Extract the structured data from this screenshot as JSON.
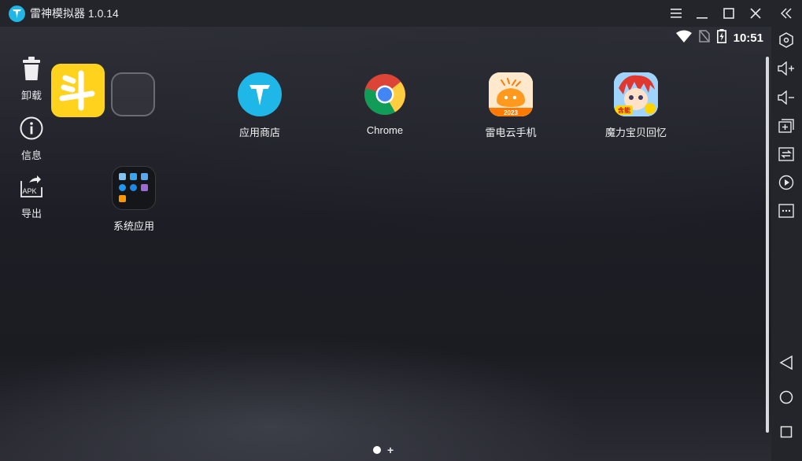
{
  "titlebar": {
    "title": "雷神模拟器 1.0.14",
    "buttons": [
      "menu-icon",
      "minimize-icon",
      "maximize-icon",
      "close-icon"
    ]
  },
  "statusbar": {
    "time": "10:51",
    "icons": [
      "wifi-icon",
      "no-sim-icon",
      "battery-charging-icon"
    ]
  },
  "left_actions": [
    {
      "id": "uninstall",
      "label": "卸载",
      "icon": "trash-icon"
    },
    {
      "id": "info",
      "label": "信息",
      "icon": "info-icon"
    },
    {
      "id": "export",
      "label": "导出",
      "icon": "apk-export-icon"
    }
  ],
  "apps": [
    {
      "id": "douyu",
      "label": "",
      "icon": "douyu-app-icon",
      "color": "#ffd21e"
    },
    {
      "id": "empty-slot",
      "label": "",
      "icon": "empty-slot-icon"
    },
    {
      "id": "app-store",
      "label": "应用商店",
      "icon": "app-store-icon",
      "color": "#1fb6e8"
    },
    {
      "id": "chrome",
      "label": "Chrome",
      "icon": "chrome-icon"
    },
    {
      "id": "leidian-cloud",
      "label": "雷电云手机",
      "icon": "leidian-cloud-icon",
      "color": "#ff8a1e"
    },
    {
      "id": "molibaobei",
      "label": "魔力宝贝回忆",
      "icon": "molibaobei-icon"
    },
    {
      "id": "system-apps",
      "label": "系统应用",
      "icon": "system-apps-folder-icon"
    }
  ],
  "leidian_cloud_badge": "2023",
  "molibaobei_badge": "含能",
  "export_badge": "APK",
  "pager": {
    "add": "+"
  },
  "toolbar": {
    "items": [
      "collapse-icon",
      "settings-icon",
      "volume-up-icon",
      "volume-down-icon",
      "add-app-icon",
      "sync-icon",
      "record-icon",
      "more-icon",
      "back-icon",
      "home-icon",
      "recents-icon"
    ]
  },
  "colors": {
    "background": "#23252b",
    "accent": "#20b6e6",
    "text": "#ffffff"
  }
}
